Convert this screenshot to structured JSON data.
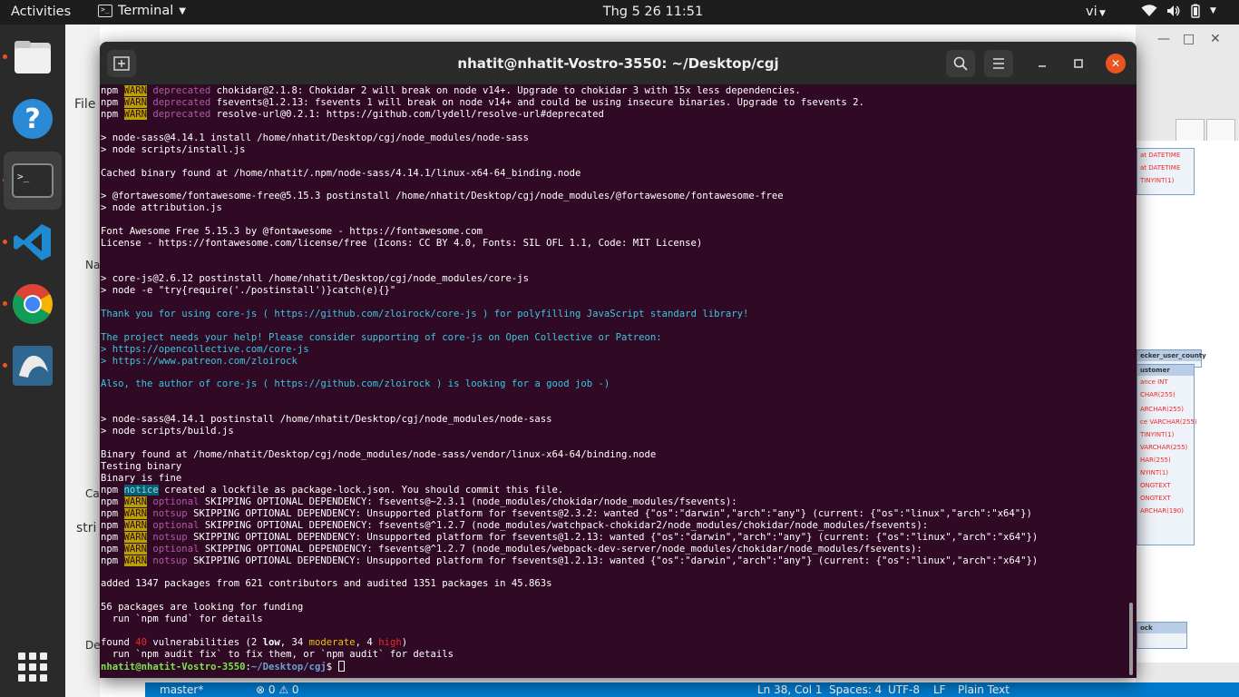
{
  "topbar": {
    "activities": "Activities",
    "app_name": "Terminal",
    "clock": "Thg 5 26  11:51",
    "language": "vi"
  },
  "dock": {
    "items": [
      "files-icon",
      "help-icon",
      "terminal-icon",
      "vscode-icon",
      "chrome-icon",
      "mysql-workbench-icon"
    ]
  },
  "background": {
    "left_labels": [
      "File",
      "Na",
      "Ca",
      "stri",
      "De"
    ],
    "er_table1_rows": [
      "at DATETIME",
      "at DATETIME",
      "TINYINT(1)"
    ],
    "er_table2_header": "ecker_user_county",
    "er_table2_sub": "ustomer",
    "er_table2_rows": [
      "ance INT",
      "CHAR(255)",
      "",
      "ARCHAR(255)",
      "ce VARCHAR(255)",
      "TINYINT(1)",
      "VARCHAR(255)",
      "HAR(255)",
      "NYINT(1)",
      "ONGTEXT",
      "ONGTEXT",
      "ARCHAR(190)"
    ],
    "er_table3_header": "ock"
  },
  "statusbar": {
    "branch": "master*",
    "problems": "⊗ 0 ⚠ 0",
    "position": "Ln 38, Col 1",
    "spaces": "Spaces: 4",
    "encoding": "UTF-8",
    "eol": "LF",
    "language": "Plain Text"
  },
  "terminal": {
    "title": "nhatit@nhatit-Vostro-3550: ~/Desktop/cgj",
    "prompt_user": "nhatit@nhatit-Vostro-3550",
    "prompt_path": "~/Desktop/cgj",
    "prompt_symbol": "$ ",
    "lines": [
      [
        {
          "t": "npm "
        },
        {
          "t": "WARN",
          "c": "w"
        },
        {
          "t": " "
        },
        {
          "t": "deprecated",
          "c": "m"
        },
        {
          "t": " chokidar@2.1.8: Chokidar 2 will break on node v14+. Upgrade to chokidar 3 with 15x less dependencies."
        }
      ],
      [
        {
          "t": "npm "
        },
        {
          "t": "WARN",
          "c": "w"
        },
        {
          "t": " "
        },
        {
          "t": "deprecated",
          "c": "m"
        },
        {
          "t": " fsevents@1.2.13: fsevents 1 will break on node v14+ and could be using insecure binaries. Upgrade to fsevents 2."
        }
      ],
      [
        {
          "t": "npm "
        },
        {
          "t": "WARN",
          "c": "w"
        },
        {
          "t": " "
        },
        {
          "t": "deprecated",
          "c": "m"
        },
        {
          "t": " resolve-url@0.2.1: https://github.com/lydell/resolve-url#deprecated"
        }
      ],
      [],
      [
        {
          "t": "> node-sass@4.14.1 install /home/nhatit/Desktop/cgj/node_modules/node-sass"
        }
      ],
      [
        {
          "t": "> node scripts/install.js"
        }
      ],
      [],
      [
        {
          "t": "Cached binary found at /home/nhatit/.npm/node-sass/4.14.1/linux-x64-64_binding.node"
        }
      ],
      [],
      [
        {
          "t": "> @fortawesome/fontawesome-free@5.15.3 postinstall /home/nhatit/Desktop/cgj/node_modules/@fortawesome/fontawesome-free"
        }
      ],
      [
        {
          "t": "> node attribution.js"
        }
      ],
      [],
      [
        {
          "t": "Font Awesome Free 5.15.3 by @fontawesome - https://fontawesome.com"
        }
      ],
      [
        {
          "t": "License - https://fontawesome.com/license/free (Icons: CC BY 4.0, Fonts: SIL OFL 1.1, Code: MIT License)"
        }
      ],
      [],
      [],
      [
        {
          "t": "> core-js@2.6.12 postinstall /home/nhatit/Desktop/cgj/node_modules/core-js"
        }
      ],
      [
        {
          "t": "> node -e \"try{require('./postinstall')}catch(e){}\""
        }
      ],
      [],
      [
        {
          "t": "Thank you for using core-js ( ",
          "c": "c"
        },
        {
          "t": "https://github.com/zloirock/core-js",
          "c": "c"
        },
        {
          "t": " ) for polyfilling JavaScript standard library!",
          "c": "c"
        }
      ],
      [],
      [
        {
          "t": "The project needs your help! Please consider supporting of core-js on Open Collective or Patreon:",
          "c": "c"
        }
      ],
      [
        {
          "t": "> ",
          "c": "c"
        },
        {
          "t": "https://opencollective.com/core-js",
          "c": "c"
        }
      ],
      [
        {
          "t": "> ",
          "c": "c"
        },
        {
          "t": "https://www.patreon.com/zloirock",
          "c": "c"
        }
      ],
      [],
      [
        {
          "t": "Also, the author of core-js ( ",
          "c": "c"
        },
        {
          "t": "https://github.com/zloirock",
          "c": "c"
        },
        {
          "t": " ) is looking for a good job -)",
          "c": "c"
        }
      ],
      [],
      [],
      [
        {
          "t": "> node-sass@4.14.1 postinstall /home/nhatit/Desktop/cgj/node_modules/node-sass"
        }
      ],
      [
        {
          "t": "> node scripts/build.js"
        }
      ],
      [],
      [
        {
          "t": "Binary found at /home/nhatit/Desktop/cgj/node_modules/node-sass/vendor/linux-x64-64/binding.node"
        }
      ],
      [
        {
          "t": "Testing binary"
        }
      ],
      [
        {
          "t": "Binary is fine"
        }
      ],
      [
        {
          "t": "npm "
        },
        {
          "t": "notice",
          "c": "n"
        },
        {
          "t": " created a lockfile as package-lock.json. You should commit this file."
        }
      ],
      [
        {
          "t": "npm "
        },
        {
          "t": "WARN",
          "c": "w"
        },
        {
          "t": " "
        },
        {
          "t": "optional",
          "c": "m"
        },
        {
          "t": " SKIPPING OPTIONAL DEPENDENCY: fsevents@~2.3.1 (node_modules/chokidar/node_modules/fsevents):"
        }
      ],
      [
        {
          "t": "npm "
        },
        {
          "t": "WARN",
          "c": "w"
        },
        {
          "t": " "
        },
        {
          "t": "notsup",
          "c": "m"
        },
        {
          "t": " SKIPPING OPTIONAL DEPENDENCY: Unsupported platform for fsevents@2.3.2: wanted {\"os\":\"darwin\",\"arch\":\"any\"} (current: {\"os\":\"linux\",\"arch\":\"x64\"})"
        }
      ],
      [
        {
          "t": "npm "
        },
        {
          "t": "WARN",
          "c": "w"
        },
        {
          "t": " "
        },
        {
          "t": "optional",
          "c": "m"
        },
        {
          "t": " SKIPPING OPTIONAL DEPENDENCY: fsevents@^1.2.7 (node_modules/watchpack-chokidar2/node_modules/chokidar/node_modules/fsevents):"
        }
      ],
      [
        {
          "t": "npm "
        },
        {
          "t": "WARN",
          "c": "w"
        },
        {
          "t": " "
        },
        {
          "t": "notsup",
          "c": "m"
        },
        {
          "t": " SKIPPING OPTIONAL DEPENDENCY: Unsupported platform for fsevents@1.2.13: wanted {\"os\":\"darwin\",\"arch\":\"any\"} (current: {\"os\":\"linux\",\"arch\":\"x64\"})"
        }
      ],
      [
        {
          "t": "npm "
        },
        {
          "t": "WARN",
          "c": "w"
        },
        {
          "t": " "
        },
        {
          "t": "optional",
          "c": "m"
        },
        {
          "t": " SKIPPING OPTIONAL DEPENDENCY: fsevents@^1.2.7 (node_modules/webpack-dev-server/node_modules/chokidar/node_modules/fsevents):"
        }
      ],
      [
        {
          "t": "npm "
        },
        {
          "t": "WARN",
          "c": "w"
        },
        {
          "t": " "
        },
        {
          "t": "notsup",
          "c": "m"
        },
        {
          "t": " SKIPPING OPTIONAL DEPENDENCY: Unsupported platform for fsevents@1.2.13: wanted {\"os\":\"darwin\",\"arch\":\"any\"} (current: {\"os\":\"linux\",\"arch\":\"x64\"})"
        }
      ],
      [],
      [
        {
          "t": "added 1347 packages from 621 contributors and audited 1351 packages in 45.863s"
        }
      ],
      [],
      [
        {
          "t": "56 packages are looking for funding"
        }
      ],
      [
        {
          "t": "  run `npm fund` for details"
        }
      ],
      [],
      [
        {
          "t": "found "
        },
        {
          "t": "40",
          "c": "r"
        },
        {
          "t": " vulnerabilities (2 "
        },
        {
          "t": "low",
          "c": "bold"
        },
        {
          "t": ", 34 "
        },
        {
          "t": "moderate",
          "c": "y"
        },
        {
          "t": ", 4 "
        },
        {
          "t": "high",
          "c": "r"
        },
        {
          "t": ")"
        }
      ],
      [
        {
          "t": "  run `npm audit fix` to fix them, or `npm audit` for details"
        }
      ]
    ]
  },
  "colors": {
    "terminal_bg": "#300a24",
    "accent": "#e95420",
    "warn_bg": "#b8a200",
    "prompt_user": "#7ee34f",
    "prompt_path": "#729fcf",
    "statusbar": "#007acc"
  }
}
